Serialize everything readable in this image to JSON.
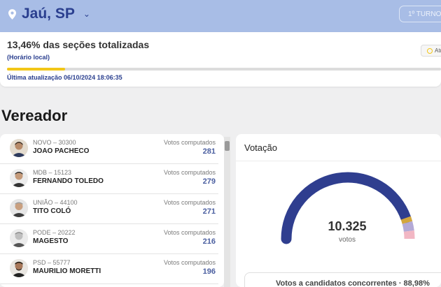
{
  "location": {
    "name": "Jaú, SP",
    "icon": "map-pin-icon"
  },
  "turn_button": {
    "label": "1º TURNO"
  },
  "status": {
    "sections_counted": "13,46% das seções totalizadas",
    "sections_fraction": 0.1346,
    "time_note": "(Horário local)",
    "last_update": "Última atualização 06/10/2024 18:06:35",
    "refresh_label": "Atu"
  },
  "office_heading": "Vereador",
  "candidates": [
    {
      "party": "NOVO – 30300",
      "name": "JOAO PACHECO",
      "votes_label": "Votos computados",
      "votes": "281"
    },
    {
      "party": "MDB – 15123",
      "name": "FERNANDO TOLEDO",
      "votes_label": "Votos computados",
      "votes": "279"
    },
    {
      "party": "UNIÃO – 44100",
      "name": "TITO COLÓ",
      "votes_label": "Votos computados",
      "votes": "271"
    },
    {
      "party": "PODE – 20222",
      "name": "MAGESTO",
      "votes_label": "Votos computados",
      "votes": "216"
    },
    {
      "party": "PSD – 55777",
      "name": "MAURILIO MORETTI",
      "votes_label": "Votos computados",
      "votes": "196"
    }
  ],
  "voting": {
    "title": "Votação",
    "total": "10.325",
    "total_label": "votos",
    "summary": "Votos a candidatos concorrentes · 88,98%",
    "gauge_segments": [
      {
        "fraction": 0.8898,
        "color": "#2f3e8f"
      },
      {
        "fraction": 0.025,
        "color": "#d3a63c"
      },
      {
        "fraction": 0.045,
        "color": "#b3a9d6"
      },
      {
        "fraction": 0.0402,
        "color": "#f2b7c4"
      }
    ]
  },
  "colors": {
    "accent": "#2a3f8f",
    "header_bg": "#a8bde6",
    "progress": "#f2c618"
  }
}
